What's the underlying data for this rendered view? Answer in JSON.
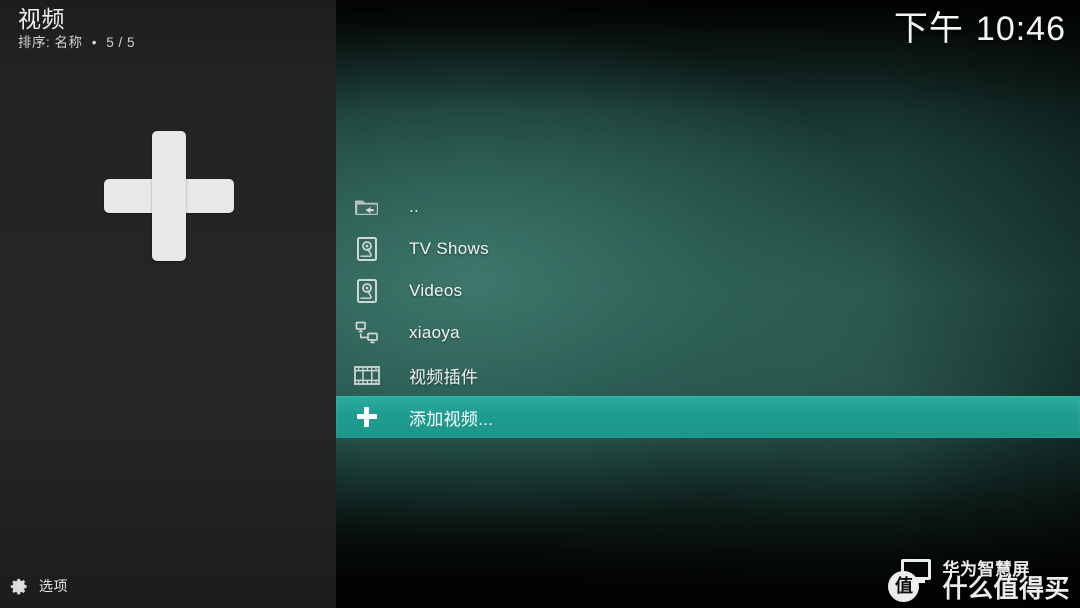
{
  "app": {
    "panel_title": "视频",
    "sort_prefix": "排序:",
    "sort_value": "名称",
    "separator": "•",
    "count": "5 / 5",
    "big_icon": "plus-icon"
  },
  "clock": {
    "period": "下午",
    "time": "10:46"
  },
  "options": {
    "label": "选项",
    "icon": "gear-icon"
  },
  "list": {
    "rows": [
      {
        "label": "..",
        "icon": "folder-parent-icon",
        "selected": false
      },
      {
        "label": "TV Shows",
        "icon": "hard-disk-icon",
        "selected": false
      },
      {
        "label": "Videos",
        "icon": "hard-disk-icon",
        "selected": false
      },
      {
        "label": "xiaoya",
        "icon": "network-computers-icon",
        "selected": false
      },
      {
        "label": "视频插件",
        "icon": "film-strip-icon",
        "selected": false
      },
      {
        "label": "添加视频...",
        "icon": "plus-icon",
        "selected": true
      }
    ]
  },
  "watermark": {
    "badge": "值",
    "line1": "华为智慧屏",
    "line2": "什么值得买",
    "icon": "monitor-icon"
  },
  "colors": {
    "highlight": "#1f9e91",
    "panel_bg": "#232525",
    "text": "#f2f4f3"
  }
}
